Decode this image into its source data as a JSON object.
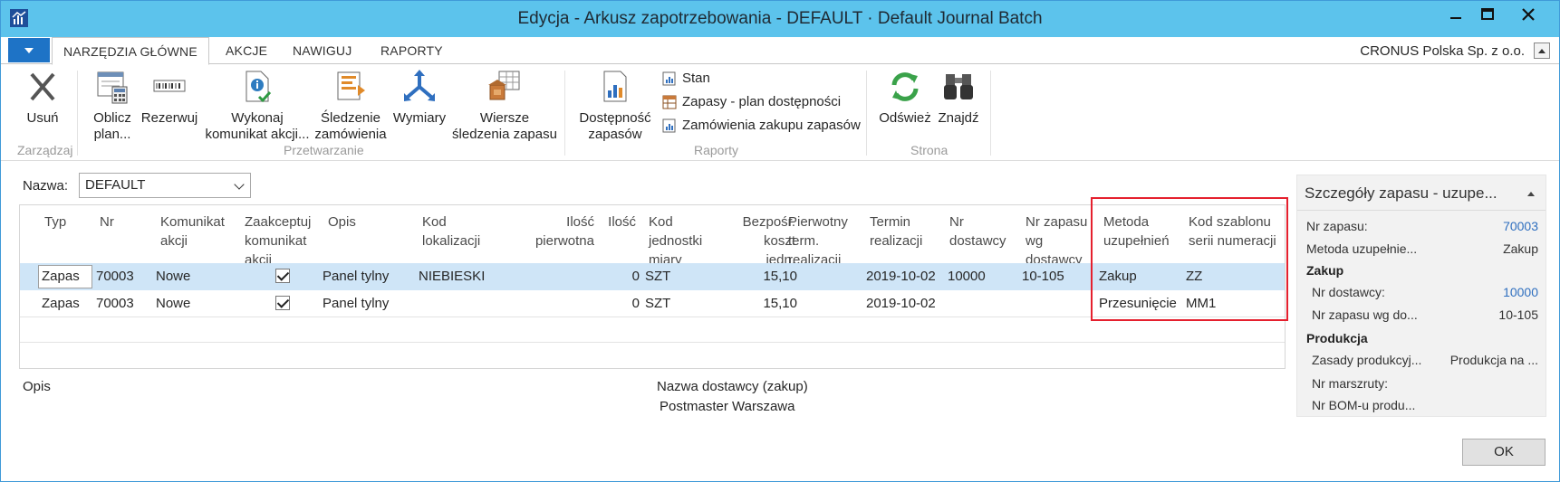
{
  "window": {
    "title": "Edycja - Arkusz zapotrzebowania - DEFAULT · Default Journal Batch"
  },
  "tabs": [
    "NARZĘDZIA GŁÓWNE",
    "AKCJE",
    "NAWIGUJ",
    "RAPORTY"
  ],
  "company": "CRONUS Polska Sp. z o.o.",
  "ribbon": {
    "delete": "Usuń",
    "group_manage": "Zarządzaj",
    "calc_plan_1": "Oblicz",
    "calc_plan_2": "plan...",
    "reserve": "Rezerwuj",
    "carry_out_1": "Wykonaj",
    "carry_out_2": "komunikat akcji...",
    "order_tracking_1": "Śledzenie",
    "order_tracking_2": "zamówienia",
    "dimensions": "Wymiary",
    "item_tracking_1": "Wiersze",
    "item_tracking_2": "śledzenia zapasu",
    "group_process": "Przetwarzanie",
    "availability_1": "Dostępność",
    "availability_2": "zapasów",
    "status": "Stan",
    "availability_plan": "Zapasy - plan dostępności",
    "purchase_orders": "Zamówienia zakupu zapasów",
    "group_reports": "Raporty",
    "refresh": "Odśwież",
    "find": "Znajdź",
    "group_page": "Strona"
  },
  "filter": {
    "label": "Nazwa:",
    "value": "DEFAULT"
  },
  "columns": {
    "typ": "Typ",
    "nr": "Nr",
    "komunikat_1": "Komunikat",
    "komunikat_2": "akcji",
    "zaakceptuj_1": "Zaakceptuj",
    "zaakceptuj_2": "komunikat",
    "zaakceptuj_3": "akcji",
    "opis": "Opis",
    "kod_lok_1": "Kod",
    "kod_lok_2": "lokalizacji",
    "ilosc_p_1": "Ilość",
    "ilosc_p_2": "pierwotna",
    "ilosc": "Ilość",
    "kod_jm_1": "Kod",
    "kod_jm_2": "jednostki",
    "kod_jm_3": "miary",
    "koszt_1": "Bezpośr.",
    "koszt_2": "koszt",
    "koszt_3": "jedn.",
    "pierw_1": "Pierwotny",
    "pierw_2": "term.",
    "pierw_3": "realizacji",
    "termin_1": "Termin",
    "termin_2": "realizacji",
    "dostawca_1": "Nr",
    "dostawca_2": "dostawcy",
    "nr_zap_1": "Nr zapasu",
    "nr_zap_2": "wg",
    "nr_zap_3": "dostawcy",
    "metoda_1": "Metoda",
    "metoda_2": "uzupełnień",
    "szablon_1": "Kod szablonu",
    "szablon_2": "serii numeracji"
  },
  "rows": [
    {
      "typ": "Zapas",
      "nr": "70003",
      "komunikat": "Nowe",
      "zaakceptuj": true,
      "opis": "Panel tylny",
      "lokalizacja": "NIEBIESKI",
      "ilosc_pierwotna": "",
      "ilosc": "0",
      "jm": "SZT",
      "koszt": "15,10",
      "pierwotny_termin": "",
      "termin": "2019-10-02",
      "dostawca": "10000",
      "nr_zapasu_dostawcy": "10-105",
      "metoda": "Zakup",
      "szablon": "ZZ"
    },
    {
      "typ": "Zapas",
      "nr": "70003",
      "komunikat": "Nowe",
      "zaakceptuj": true,
      "opis": "Panel tylny",
      "lokalizacja": "",
      "ilosc_pierwotna": "",
      "ilosc": "0",
      "jm": "SZT",
      "koszt": "15,10",
      "pierwotny_termin": "",
      "termin": "2019-10-02",
      "dostawca": "",
      "nr_zapasu_dostawcy": "",
      "metoda": "Przesunięcie",
      "szablon": "MM1"
    }
  ],
  "footer": {
    "opis_label": "Opis",
    "vendor_label": "Nazwa dostawcy (zakup)",
    "vendor_value": "Postmaster Warszawa"
  },
  "factbox": {
    "title": "Szczegóły zapasu - uzupe...",
    "nr_zapasu_label": "Nr zapasu:",
    "nr_zapasu_value": "70003",
    "metoda_label": "Metoda uzupełnie...",
    "metoda_value": "Zakup",
    "zakup_header": "Zakup",
    "nr_dostawcy_label": "Nr dostawcy:",
    "nr_dostawcy_value": "10000",
    "nr_zap_dost_label": "Nr zapasu wg do...",
    "nr_zap_dost_value": "10-105",
    "produkcja_header": "Produkcja",
    "zasady_label": "Zasady produkcyj...",
    "zasady_value": "Produkcja na ...",
    "marszruta_label": "Nr marszruty:",
    "bom_label": "Nr BOM-u produ..."
  },
  "ok_label": "OK",
  "colors": {
    "titlebar": "#5cc3ec",
    "selected_row": "#cfe5f7",
    "highlight_border": "#e5202e",
    "link": "#2f6fbf"
  }
}
